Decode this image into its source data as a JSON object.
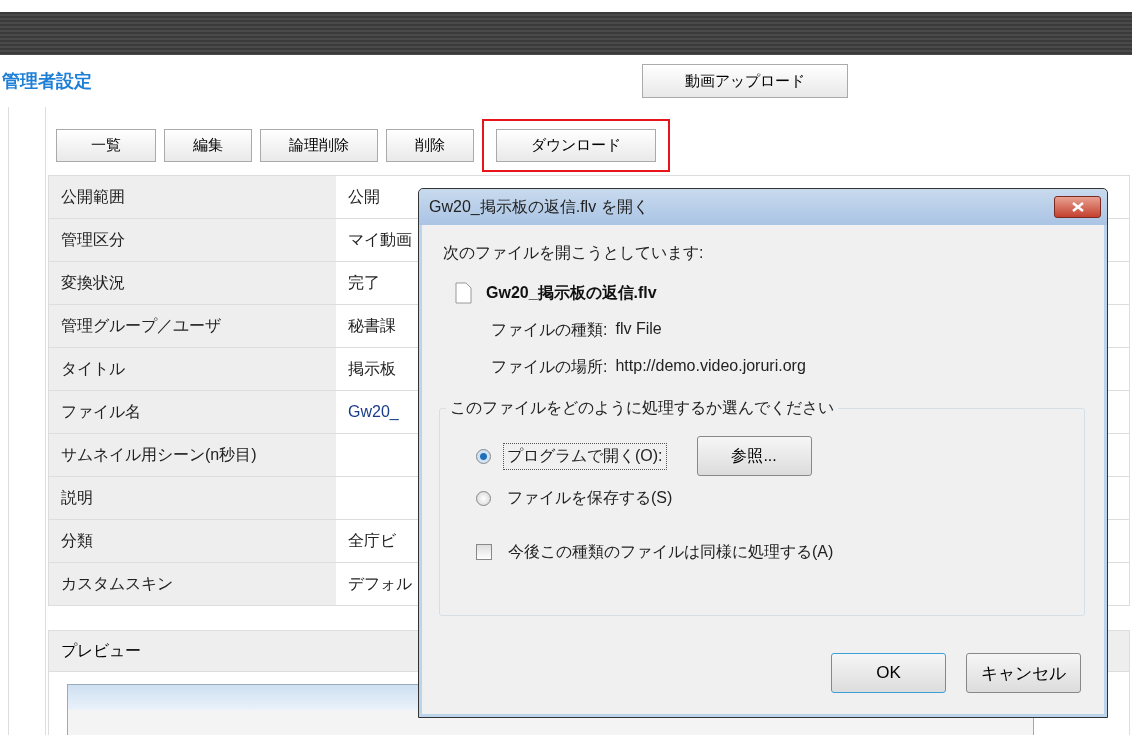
{
  "header": {
    "title": "管理者設定",
    "upload_button": "動画アップロード"
  },
  "toolbar": [
    {
      "label": "一覧",
      "highlighted": false
    },
    {
      "label": "編集",
      "highlighted": false
    },
    {
      "label": "論理削除",
      "highlighted": false
    },
    {
      "label": "削除",
      "highlighted": false
    },
    {
      "label": "ダウンロード",
      "highlighted": true
    }
  ],
  "details": [
    {
      "label": "公開範囲",
      "value": "公開",
      "kind": "text"
    },
    {
      "label": "管理区分",
      "value": "マイ動画",
      "kind": "text"
    },
    {
      "label": "変換状況",
      "value": "完了",
      "kind": "text"
    },
    {
      "label": "管理グループ／ユーザ",
      "value": "秘書課",
      "kind": "text"
    },
    {
      "label": "タイトル",
      "value": "掲示板",
      "kind": "text"
    },
    {
      "label": "ファイル名",
      "value": "Gw20_",
      "kind": "link"
    },
    {
      "label": "サムネイル用シーン(n秒目)"
    },
    {
      "label": "説明"
    },
    {
      "label": "分類",
      "value": "全庁ビ",
      "kind": "text"
    },
    {
      "label": "カスタムスキン",
      "value": "デフォル",
      "kind": "text"
    }
  ],
  "preview": {
    "title": "プレビュー"
  },
  "dialog": {
    "title": "Gw20_掲示板の返信.flv を開く",
    "intro": "次のファイルを開こうとしています:",
    "file_name": "Gw20_掲示板の返信.flv",
    "file_type_label": "ファイルの種類:",
    "file_type": "flv File",
    "location_label": "ファイルの場所:",
    "location": "http://demo.video.joruri.org",
    "group_title": "このファイルをどのように処理するか選んでください",
    "options": [
      {
        "label": "プログラムで開く(O):",
        "selected": true,
        "button": "参照..."
      },
      {
        "label": "ファイルを保存する(S)",
        "selected": false
      }
    ],
    "remember": {
      "label": "今後この種類のファイルは同様に処理する(A)",
      "checked": false
    },
    "buttons": [
      {
        "label": "OK",
        "kind": "default"
      },
      {
        "label": "キャンセル",
        "kind": "normal"
      }
    ]
  }
}
